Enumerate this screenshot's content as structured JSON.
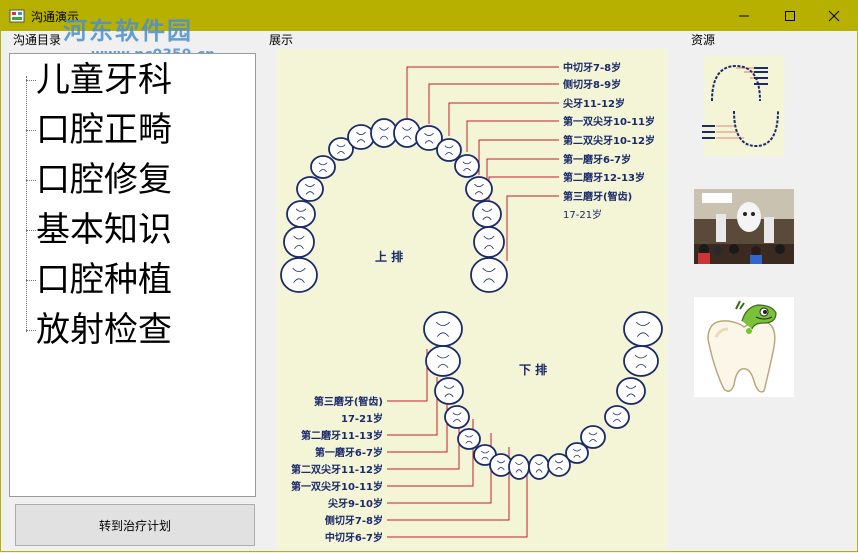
{
  "window": {
    "title": "沟通演示"
  },
  "watermark": {
    "text": "河东软件园",
    "url": "www.pc0359.cn"
  },
  "groups": {
    "directory": "沟通目录",
    "display": "展示",
    "resources": "资源"
  },
  "tree": {
    "items": [
      "儿童牙科",
      "口腔正畸",
      "口腔修复",
      "基本知识",
      "口腔种植",
      "放射检查"
    ]
  },
  "button": {
    "label": "转到治疗计划"
  },
  "chart": {
    "upper_title": "上  排",
    "lower_title": "下  排",
    "upper_labels": [
      "中切牙7-8岁",
      "侧切牙8-9岁",
      "尖牙11-12岁",
      "第一双尖牙10-11岁",
      "第二双尖牙10-12岁",
      "第一磨牙6-7岁",
      "第二磨牙12-13岁",
      "第三磨牙(智齿)",
      "17-21岁"
    ],
    "lower_labels": [
      "第三磨牙(智齿)",
      "17-21岁",
      "第二磨牙11-13岁",
      "第一磨牙6-7岁",
      "第二双尖牙11-12岁",
      "第一双尖牙10-11岁",
      "尖牙9-10岁",
      "侧切牙7-8岁",
      "中切牙6-7岁"
    ]
  },
  "icons": {
    "app": "app-icon",
    "minimize": "minimize-icon",
    "maximize": "maximize-icon",
    "close": "close-icon"
  },
  "colors": {
    "titlebar": "#b8b000",
    "chart_background": "#f3f5d6",
    "chart_lines": "#c0202a",
    "tooth_outline": "#1a2a6a"
  }
}
